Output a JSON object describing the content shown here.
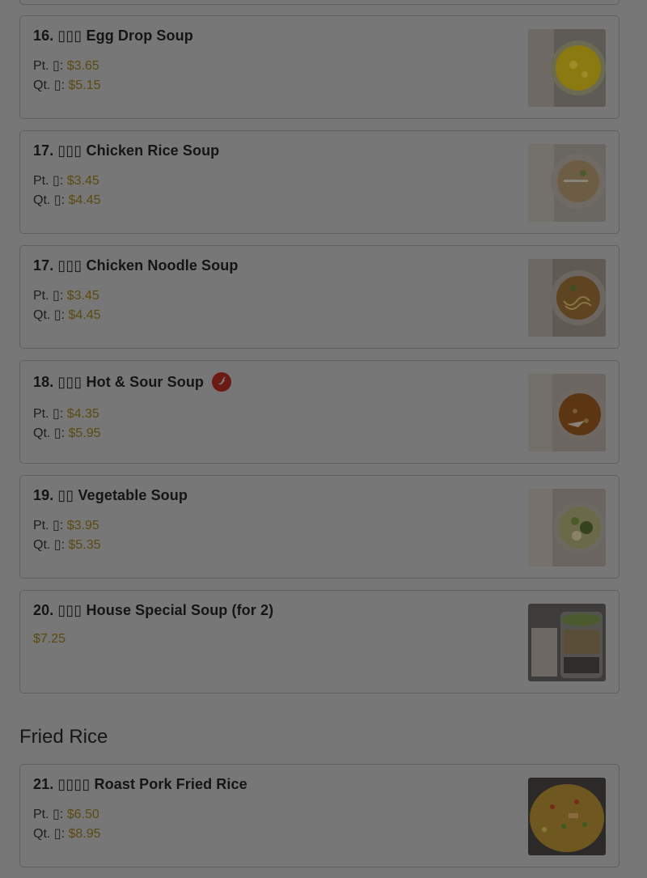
{
  "section": {
    "title": "Fried Rice"
  },
  "items": [
    {
      "name": "16. ▯▯▯ Egg Drop Soup",
      "lines": [
        {
          "label": "Pt. ▯: ",
          "value": "$3.65"
        },
        {
          "label": "Qt. ▯: ",
          "value": "$5.15"
        }
      ]
    },
    {
      "name": "17. ▯▯▯ Chicken Rice Soup",
      "lines": [
        {
          "label": "Pt. ▯: ",
          "value": "$3.45"
        },
        {
          "label": "Qt. ▯: ",
          "value": "$4.45"
        }
      ]
    },
    {
      "name": "17. ▯▯▯ Chicken Noodle Soup",
      "lines": [
        {
          "label": "Pt. ▯: ",
          "value": "$3.45"
        },
        {
          "label": "Qt. ▯: ",
          "value": "$4.45"
        }
      ]
    },
    {
      "name": "18. ▯▯▯ Hot & Sour Soup",
      "spicy": true,
      "lines": [
        {
          "label": "Pt. ▯: ",
          "value": "$4.35"
        },
        {
          "label": "Qt. ▯: ",
          "value": "$5.95"
        }
      ]
    },
    {
      "name": "19. ▯▯ Vegetable Soup",
      "lines": [
        {
          "label": "Pt. ▯: ",
          "value": "$3.95"
        },
        {
          "label": "Qt. ▯: ",
          "value": "$5.35"
        }
      ]
    },
    {
      "name": "20. ▯▯▯ House Special Soup (for 2)",
      "lines": [
        {
          "label": "",
          "value": "$7.25"
        }
      ]
    },
    {
      "name": "21. ▯▯▯▯ Roast Pork Fried Rice",
      "lines": [
        {
          "label": "Pt. ▯: ",
          "value": "$6.50"
        },
        {
          "label": "Qt. ▯: ",
          "value": "$8.95"
        }
      ]
    }
  ],
  "icons": {
    "spicy": "chili-pepper-icon",
    "thumbnail": "food-photo"
  },
  "colors": {
    "overlay": "#777777",
    "price": "#5b4a0f",
    "spicy_badge": "#6c1a14"
  }
}
